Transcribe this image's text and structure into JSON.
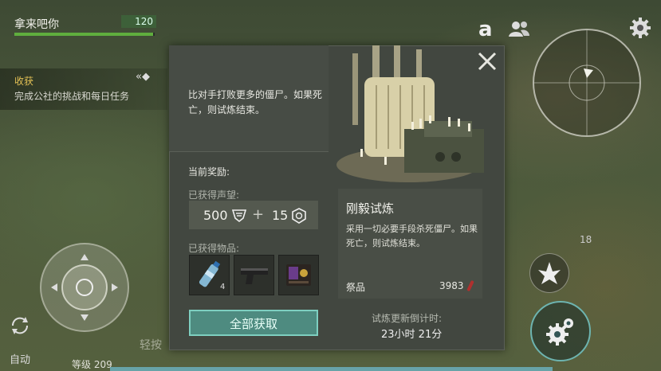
{
  "player": {
    "name": "拿来吧你",
    "hp": "120",
    "hp_fraction": 0.99,
    "level": "等级 209"
  },
  "quest": {
    "title": "收获",
    "description": "完成公社的挑战和每日任务"
  },
  "hud": {
    "auto_label": "自动",
    "chat_placeholder": "轻按",
    "right_number": "18",
    "top_letter": "a"
  },
  "dialog": {
    "description": "比对手打败更多的僵尸。如果死亡，则试炼结束。",
    "rewards_label": "当前奖励:",
    "reputation_label": "已获得声望:",
    "reputation_a": "500",
    "reputation_plus": "+",
    "reputation_b": "15",
    "items_label": "已获得物品:",
    "items": [
      {
        "name": "water-bottle",
        "count": "4"
      },
      {
        "name": "pistol",
        "count": ""
      },
      {
        "name": "badge",
        "count": ""
      }
    ],
    "claim_button": "全部获取",
    "trial_title": "刚毅试炼",
    "trial_description": "采用一切必要手段杀死僵尸。如果死亡，则试炼结束。",
    "offering_label": "祭品",
    "offering_value": "3983",
    "timer_label": "试炼更新倒计时:",
    "timer_value": "23小时 21分"
  },
  "colors": {
    "accent": "#7ecfc0",
    "button": "#4e8b80",
    "hp": "#5fae3e",
    "quest_title": "#e3c155"
  }
}
